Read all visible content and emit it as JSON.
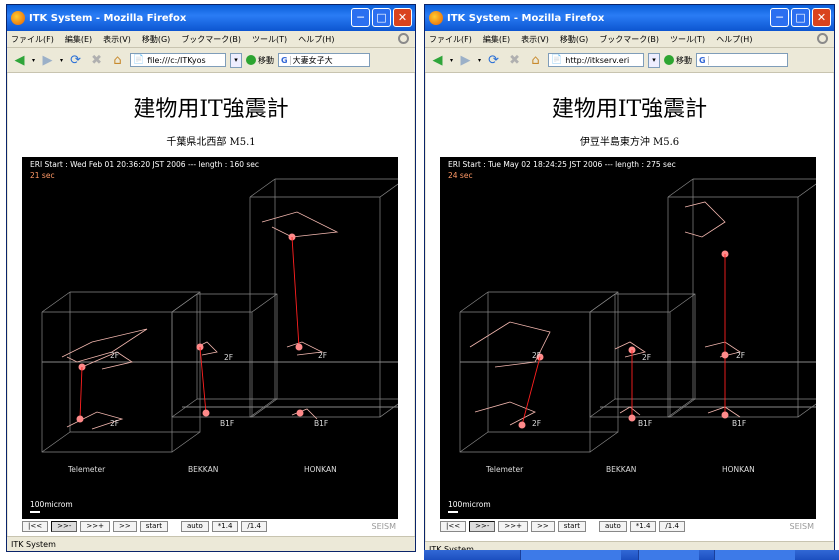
{
  "windows": [
    {
      "title": "ITK System - Mozilla Firefox",
      "menu": [
        "ファイル(F)",
        "編集(E)",
        "表示(V)",
        "移動(G)",
        "ブックマーク(B)",
        "ツール(T)",
        "ヘルプ(H)"
      ],
      "url": "file:///c:/ITKyos",
      "go_label": "移動",
      "search_text": "大妻女子大",
      "page_title": "建物用IT強震計",
      "event_title": "千葉県北西部 M5.1",
      "info": "ERI    Start : Wed Feb 01 20:36:20 JST 2006  ---  length : 160 sec",
      "elapsed": "21 sec",
      "floor_labels": [
        "2F",
        "2F",
        "2F",
        "B1F",
        "B1F",
        "2F",
        "2F"
      ],
      "building_labels": [
        "Telemeter",
        "BEKKAN",
        "HONKAN"
      ],
      "scale": "100microm",
      "controls": [
        "|<<",
        ">>-",
        ">>+",
        ">>",
        "start",
        "auto",
        "*1.4",
        "/1.4"
      ],
      "brand": "SEISM",
      "status": "ITK System"
    },
    {
      "title": "ITK System - Mozilla Firefox",
      "menu": [
        "ファイル(F)",
        "編集(E)",
        "表示(V)",
        "移動(G)",
        "ブックマーク(B)",
        "ツール(T)",
        "ヘルプ(H)"
      ],
      "url": "http://itkserv.eri",
      "go_label": "移動",
      "search_text": "",
      "page_title": "建物用IT強震計",
      "event_title": "伊豆半島東方沖 M5.6",
      "info": "ERI    Start : Tue May 02 18:24:25 JST 2006  ---  length : 275 sec",
      "elapsed": "24 sec",
      "floor_labels": [
        "2F",
        "2F",
        "2F",
        "B1F",
        "B1F",
        "2F",
        "2F"
      ],
      "building_labels": [
        "Telemeter",
        "BEKKAN",
        "HONKAN"
      ],
      "scale": "100microm",
      "controls": [
        "|<<",
        ">>-",
        ">>+",
        ">>",
        "start",
        "auto",
        "*1.4",
        "/1.4"
      ],
      "brand": "SEISM",
      "status": "ITK System"
    }
  ],
  "colors": {
    "titlebar": "#0a5fd8",
    "viewer_bg": "#000000",
    "wire": "#888888",
    "trace": "#f4b8b0",
    "sensor": "#ff8a8a",
    "link": "#ff2020",
    "elapsed": "#ff9966"
  }
}
